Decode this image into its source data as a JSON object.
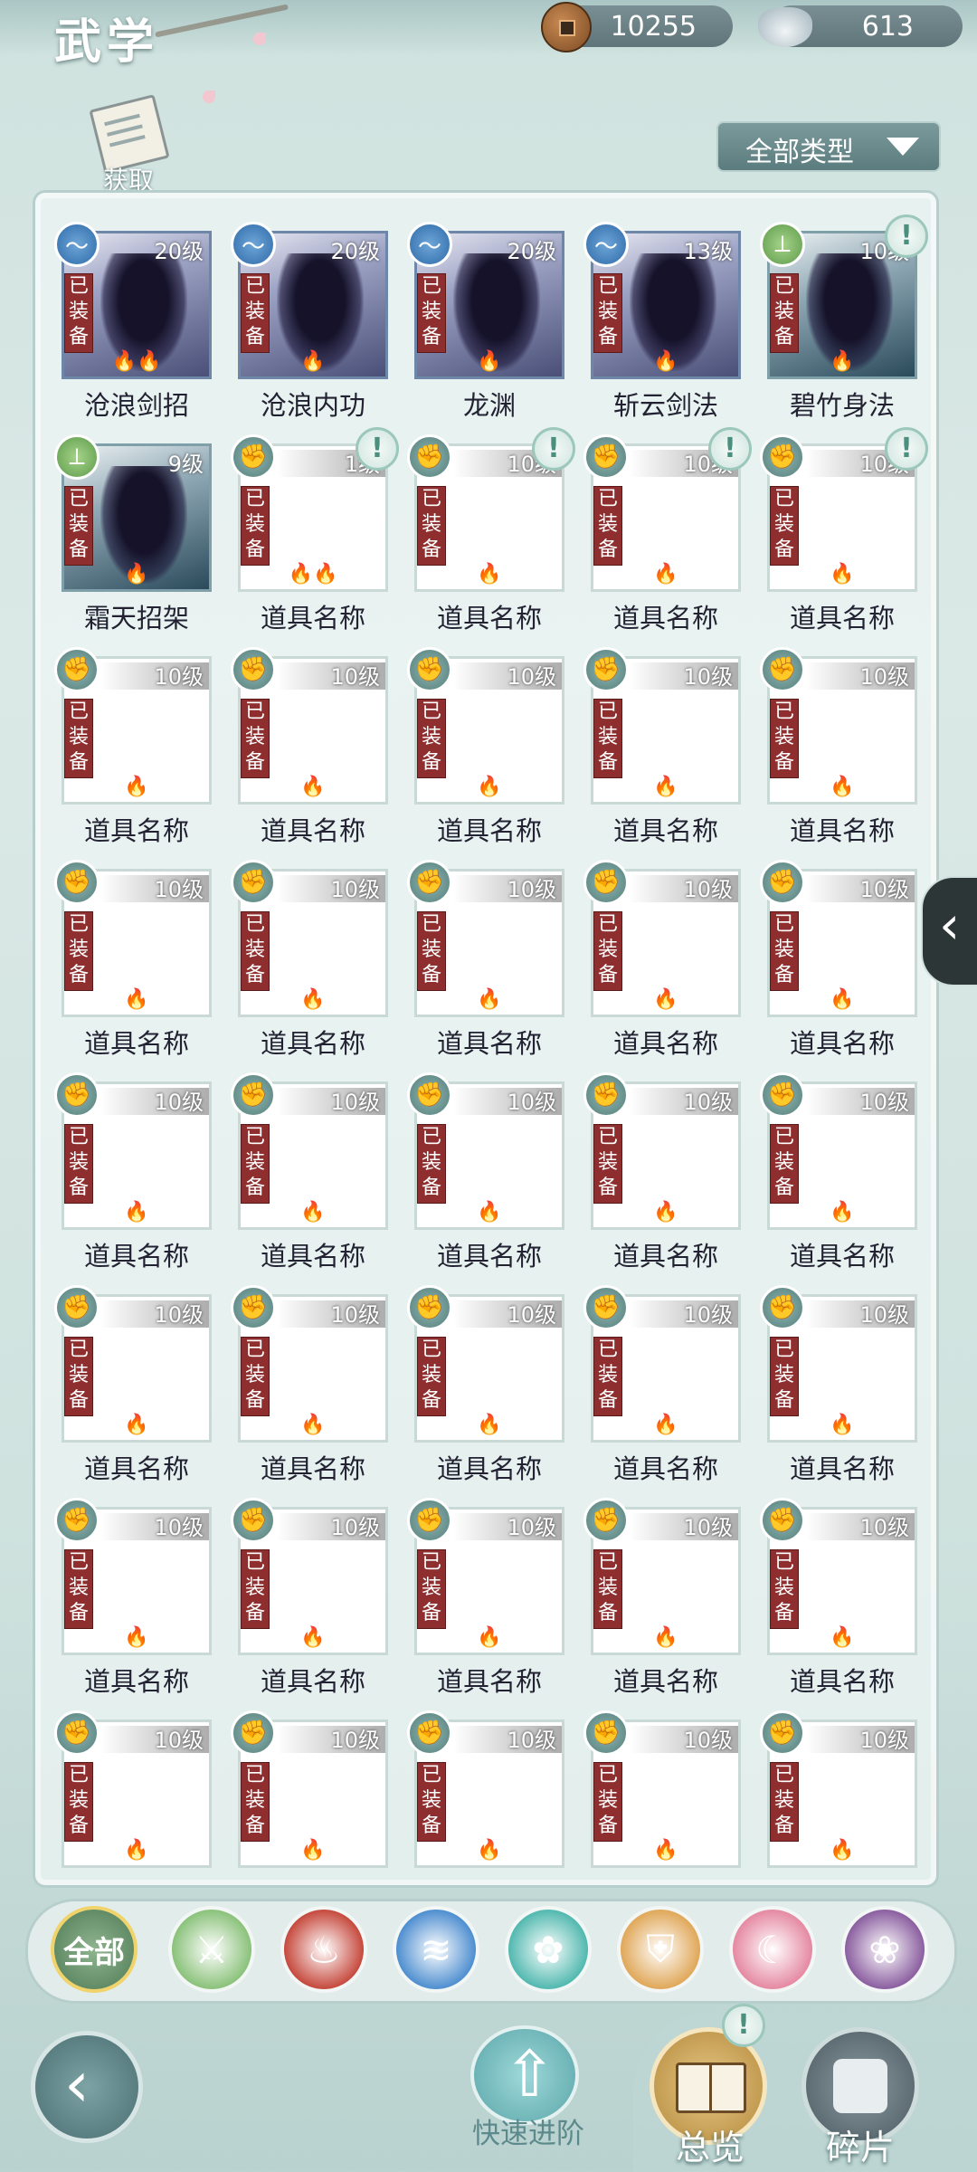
{
  "header": {
    "title": "武学",
    "currency": [
      {
        "icon": "copper-coin-icon",
        "value": "10255"
      },
      {
        "icon": "silver-ingot-icon",
        "value": "613"
      }
    ]
  },
  "acquire_label": "获取",
  "filter_label": "全部类型",
  "equipped_label": "已\n装\n备",
  "items": [
    {
      "name": "沧浪剑招",
      "level": "20级",
      "element": "water",
      "flames": "🔥🔥",
      "art": true
    },
    {
      "name": "沧浪内功",
      "level": "20级",
      "element": "water",
      "flames": "🔥",
      "art": true
    },
    {
      "name": "龙渊",
      "level": "20级",
      "element": "water",
      "flames": "🔥",
      "art": true
    },
    {
      "name": "斩云剑法",
      "level": "13级",
      "element": "water",
      "flames": "🔥",
      "art": true
    },
    {
      "name": "碧竹身法",
      "level": "10级",
      "element": "bamboo",
      "flames": "🔥",
      "art": true,
      "alert": true
    },
    {
      "name": "霜天招架",
      "level": "9级",
      "element": "bamboo",
      "flames": "🔥",
      "art": true
    },
    {
      "name": "道具名称",
      "level": "1级",
      "element": "fist",
      "flames": "🔥🔥",
      "alert": true
    },
    {
      "name": "道具名称",
      "level": "10级",
      "element": "fist",
      "flames": "🔥",
      "alert": true
    },
    {
      "name": "道具名称",
      "level": "10级",
      "element": "fist",
      "flames": "🔥",
      "alert": true
    },
    {
      "name": "道具名称",
      "level": "10级",
      "element": "fist",
      "flames": "🔥",
      "alert": true
    }
  ],
  "placeholder_item": {
    "name": "道具名称",
    "level": "10级",
    "flames": "🔥"
  },
  "categories": [
    {
      "id": "all",
      "label": "全部",
      "icon": "all-icon",
      "color": "#6f9a72"
    },
    {
      "id": "sword",
      "icon": "sword-icon",
      "color": "#8bc27b"
    },
    {
      "id": "fire",
      "icon": "flame-icon",
      "color": "#c64a3e"
    },
    {
      "id": "wave",
      "icon": "wave-icon",
      "color": "#4f8fd0"
    },
    {
      "id": "butterfly",
      "icon": "butterfly-icon",
      "color": "#52b9b0"
    },
    {
      "id": "shield",
      "icon": "shield-icon",
      "color": "#e0a85a"
    },
    {
      "id": "moon",
      "icon": "moon-icon",
      "color": "#e58aa3"
    },
    {
      "id": "rose",
      "icon": "rose-icon",
      "color": "#8b5fa0"
    }
  ],
  "bottom": {
    "quick_label": "快速进阶",
    "overview_label": "总览",
    "fragments_label": "碎片"
  }
}
